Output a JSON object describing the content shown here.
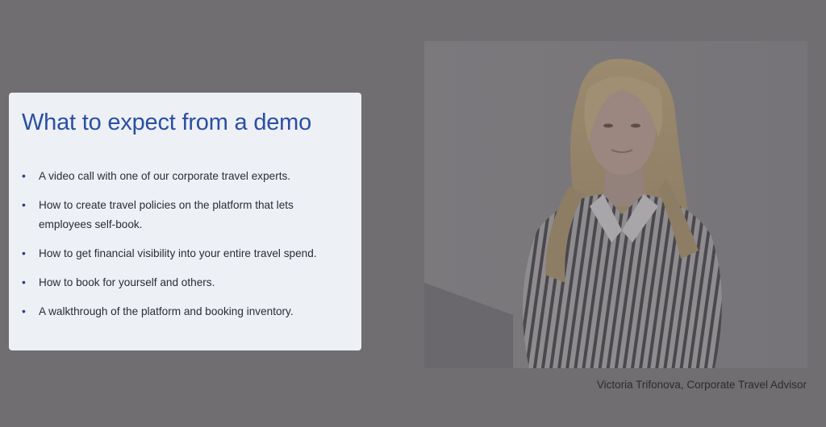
{
  "card": {
    "title": "What to expect from a demo",
    "items": [
      "A video call with one of our corporate travel experts.",
      "How to create travel policies on the platform that lets employees self-book.",
      "How to get financial visibility into your entire travel spend.",
      "How to book for yourself and others.",
      "A walkthrough of the platform and booking inventory."
    ]
  },
  "photo": {
    "caption": "Victoria Trifonova, Corporate Travel Advisor"
  },
  "colors": {
    "overlay": "#706e71",
    "card_bg": "#edf0f5",
    "title": "#2b4fa3",
    "bullet": "#2c3e7e"
  }
}
